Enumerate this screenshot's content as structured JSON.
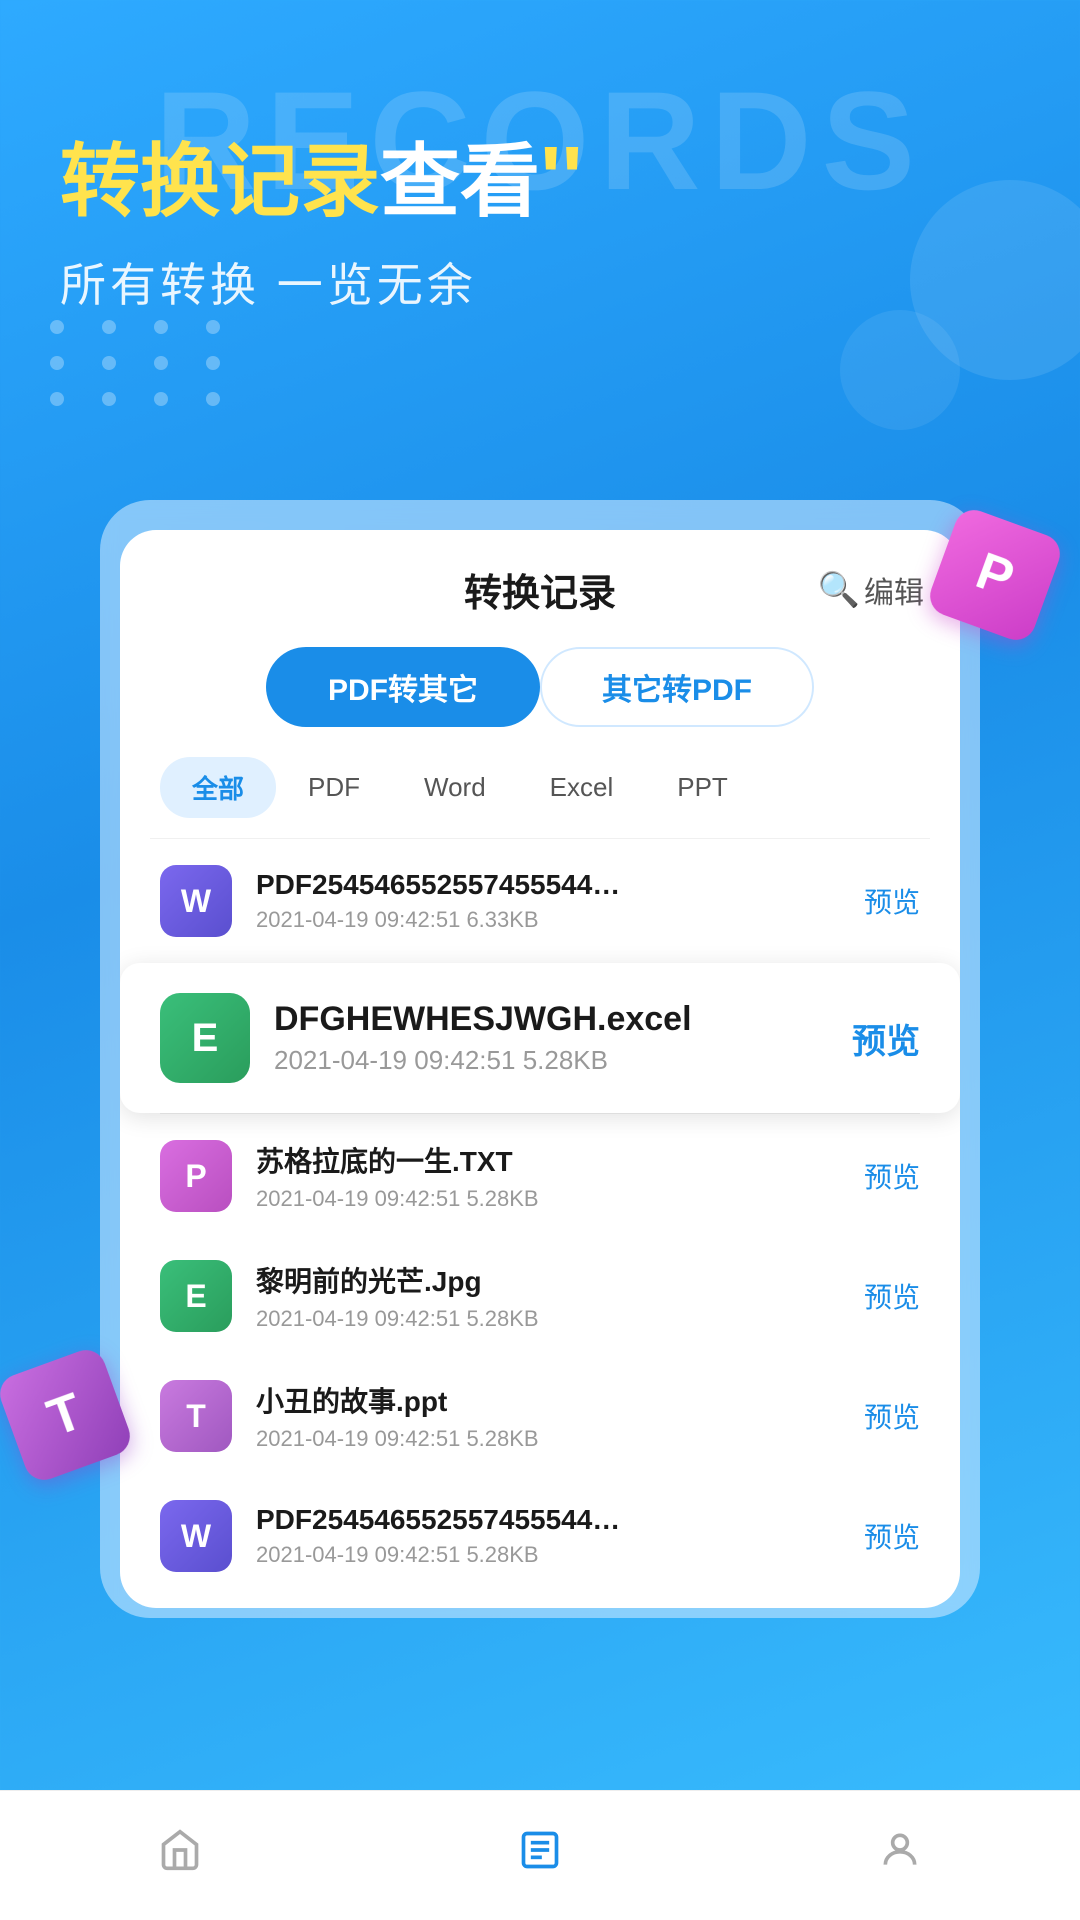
{
  "background": {
    "records_text": "RECORDS",
    "subtitle_dots": 12
  },
  "header": {
    "main_title_yellow": "转换记录",
    "main_title_white": "查看",
    "quote_mark": "''",
    "subtitle": "所有转换  一览无余"
  },
  "card": {
    "title": "转换记录",
    "search_label": "搜索",
    "edit_label": "编辑",
    "tabs": [
      {
        "id": "pdf-to-other",
        "label": "PDF转其它",
        "active": true
      },
      {
        "id": "other-to-pdf",
        "label": "其它转PDF",
        "active": false
      }
    ],
    "filters": [
      {
        "id": "all",
        "label": "全部",
        "active": true
      },
      {
        "id": "pdf",
        "label": "PDF",
        "active": false
      },
      {
        "id": "word",
        "label": "Word",
        "active": false
      },
      {
        "id": "excel",
        "label": "Excel",
        "active": false
      },
      {
        "id": "ppt",
        "label": "PPT",
        "active": false
      }
    ],
    "files": [
      {
        "id": "file1",
        "icon_letter": "W",
        "icon_class": "icon-word",
        "name": "PDF254546552557455544…",
        "date": "2021-04-19",
        "time": "09:42:51",
        "size": "6.33KB",
        "preview_label": "预览",
        "highlighted": false
      },
      {
        "id": "file2",
        "icon_letter": "E",
        "icon_class": "icon-excel",
        "name": "DFGHEWHESJWGH.excel",
        "date": "2021-04-19",
        "time": "09:42:51",
        "size": "5.28KB",
        "preview_label": "预览",
        "highlighted": true
      },
      {
        "id": "file3",
        "icon_letter": "P",
        "icon_class": "icon-txt",
        "name": "苏格拉底的一生.TXT",
        "date": "2021-04-19",
        "time": "09:42:51",
        "size": "5.28KB",
        "preview_label": "预览",
        "highlighted": false
      },
      {
        "id": "file4",
        "icon_letter": "E",
        "icon_class": "icon-jpg",
        "name": "黎明前的光芒.Jpg",
        "date": "2021-04-19",
        "time": "09:42:51",
        "size": "5.28KB",
        "preview_label": "预览",
        "highlighted": false
      },
      {
        "id": "file5",
        "icon_letter": "T",
        "icon_class": "icon-ppt",
        "name": "小丑的故事.ppt",
        "date": "2021-04-19",
        "time": "09:42:51",
        "size": "5.28KB",
        "preview_label": "预览",
        "highlighted": false
      },
      {
        "id": "file6",
        "icon_letter": "W",
        "icon_class": "icon-w2",
        "name": "PDF254546552557455544…",
        "date": "2021-04-19",
        "time": "09:42:51",
        "size": "5.28KB",
        "preview_label": "预览",
        "highlighted": false
      }
    ]
  },
  "float_badges": {
    "p_letter": "P",
    "t_letter": "T"
  },
  "bottom_nav": [
    {
      "id": "home",
      "icon": "🏠",
      "label": "首页",
      "active": false
    },
    {
      "id": "records",
      "icon": "☰",
      "label": "记录",
      "active": true
    },
    {
      "id": "profile",
      "icon": "👤",
      "label": "我的",
      "active": false
    }
  ]
}
